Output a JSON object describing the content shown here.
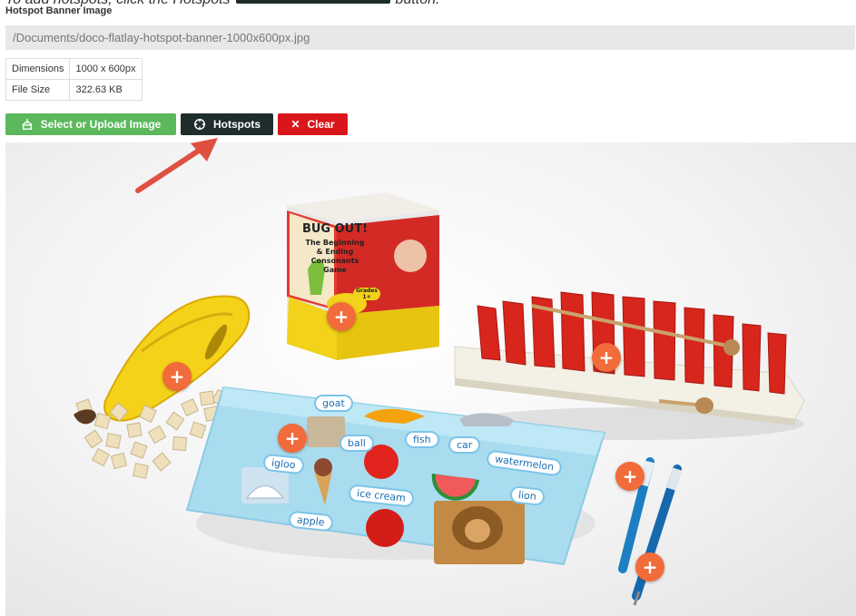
{
  "instruction": {
    "before": "To add hotspots, click the Hotspots",
    "after": "button."
  },
  "field": {
    "label": "Hotspot Banner Image",
    "path": "/Documents/doco-flatlay-hotspot-banner-1000x600px.jpg"
  },
  "meta": {
    "dimensions_label": "Dimensions",
    "dimensions_value": "1000 x 600px",
    "filesize_label": "File Size",
    "filesize_value": "322.63 KB"
  },
  "buttons": {
    "select_label": "Select or Upload Image",
    "hotspots_label": "Hotspots",
    "clear_label": "Clear"
  },
  "colors": {
    "select": "#5cb85c",
    "hotspots": "#1f2d2d",
    "clear": "#d9161c",
    "hotspot_marker": "#f26b3a",
    "arrow": "#e05040"
  },
  "hotspot_symbol": "+",
  "box": {
    "title": "BUG OUT!",
    "line1": "The Beginning",
    "line2": "& Ending",
    "line3": "Consonants",
    "line4": "Game",
    "grades": "Grades 1+"
  },
  "mat_words": {
    "goat": "goat",
    "fish": "fish",
    "car": "car",
    "ball": "ball",
    "igloo": "igloo",
    "watermelon": "watermelon",
    "ice_cream": "ice cream",
    "lion": "lion",
    "apple": "apple"
  }
}
